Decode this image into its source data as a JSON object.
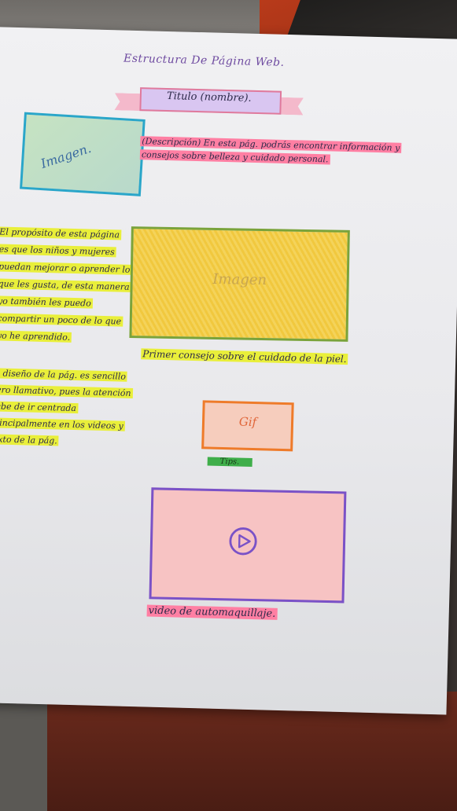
{
  "page_title": "Estructura De Página Web.",
  "ribbon_title": "Titulo (nombre).",
  "image_label_1": "Imagen.",
  "description": "(Descripción) En esta pág. podrás encontrar información y consejos sobre belleza y cuidado personal.",
  "purpose_text": "El propósito de esta página es que los niños y mujeres puedan mejorar o aprender lo que les gusta, de esta manera yo también les puedo compartir un poco de lo que yo he aprendido.",
  "design_text": "El diseño de la pág. es sencillo pero llamativo, pues la atención debe de ir centrada principalmente en los videos y texto de la pág.",
  "image_label_2": "Imagen",
  "caption_1": "Primer consejo sobre el cuidado de la piel.",
  "gif_label": "Gif",
  "tips_label": "Tips.",
  "video_caption": "video de automaquillaje.",
  "colors": {
    "pink_highlight": "#ff7fa3",
    "yellow_highlight": "#e9ef3a",
    "green_highlight": "#3fae4a",
    "blue_border": "#2aa6c9",
    "green_border": "#7aa33a",
    "orange_border": "#ee7b2a",
    "purple_border": "#7a52c7"
  },
  "icons": {
    "play": "play-icon"
  }
}
